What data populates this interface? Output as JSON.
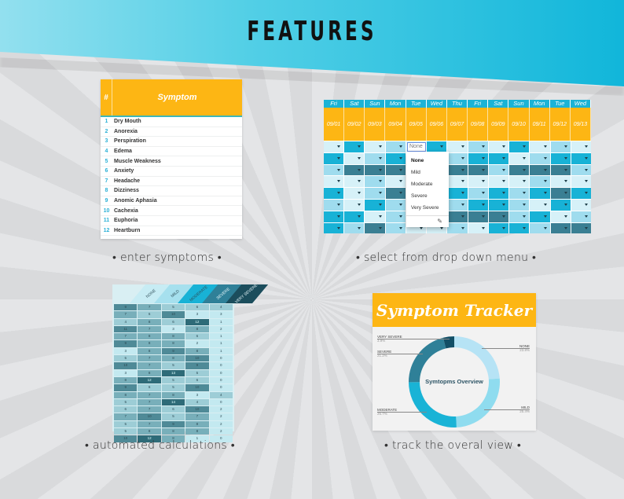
{
  "page": {
    "title": "FEATURES",
    "captions": [
      "• enter symptoms •",
      "• select from drop down menu •",
      "• automated calculations •",
      "• track the overal view •"
    ]
  },
  "symptom_list": {
    "header_hash": "#",
    "header_label": "Symptom",
    "rows": [
      {
        "num": "1",
        "name": "Dry Mouth"
      },
      {
        "num": "2",
        "name": "Anorexia"
      },
      {
        "num": "3",
        "name": "Perspiration"
      },
      {
        "num": "4",
        "name": "Edema"
      },
      {
        "num": "5",
        "name": "Muscle Weakness"
      },
      {
        "num": "6",
        "name": "Anxiety"
      },
      {
        "num": "7",
        "name": "Headache"
      },
      {
        "num": "8",
        "name": "Dizziness"
      },
      {
        "num": "9",
        "name": "Anomic Aphasia"
      },
      {
        "num": "10",
        "name": "Cachexia"
      },
      {
        "num": "11",
        "name": "Euphoria"
      },
      {
        "num": "12",
        "name": "Heartburn"
      }
    ]
  },
  "tracker_grid": {
    "days": [
      "Fri",
      "Sat",
      "Sun",
      "Mon",
      "Tue",
      "Wed",
      "Thu",
      "Fri",
      "Sat",
      "Sun",
      "Mon",
      "Tue",
      "Wed"
    ],
    "dates": [
      "09/01",
      "09/02",
      "09/03",
      "09/04",
      "09/05",
      "09/06",
      "09/07",
      "09/08",
      "09/09",
      "09/10",
      "09/11",
      "09/12",
      "09/13"
    ],
    "severity_levels": [
      [
        0,
        2,
        0,
        1,
        0,
        2,
        0,
        1,
        0,
        2,
        0,
        1,
        0
      ],
      [
        2,
        0,
        1,
        2,
        0,
        0,
        1,
        2,
        2,
        0,
        1,
        2,
        2
      ],
      [
        1,
        3,
        3,
        3,
        0,
        0,
        3,
        3,
        1,
        3,
        3,
        3,
        1
      ],
      [
        0,
        0,
        1,
        0,
        0,
        0,
        0,
        0,
        0,
        0,
        1,
        0,
        0
      ],
      [
        2,
        0,
        1,
        3,
        0,
        0,
        2,
        1,
        2,
        1,
        2,
        3,
        2
      ],
      [
        1,
        0,
        2,
        1,
        0,
        0,
        1,
        2,
        2,
        1,
        0,
        2,
        0
      ],
      [
        2,
        2,
        0,
        1,
        0,
        0,
        3,
        3,
        3,
        1,
        2,
        0,
        1
      ],
      [
        2,
        1,
        3,
        1,
        0,
        0,
        1,
        0,
        2,
        2,
        1,
        3,
        3
      ]
    ],
    "dropdown": {
      "current_value": "None",
      "options": [
        "None",
        "Mild",
        "Moderate",
        "Severe",
        "Very Severe"
      ],
      "edit_icon": "pencil-icon"
    }
  },
  "calculations": {
    "headers": [
      "NONE",
      "MILD",
      "MODERATE",
      "SEVERE",
      "VERY SEVERE"
    ],
    "rows": [
      [
        "9",
        "7",
        "5",
        "6",
        "4"
      ],
      [
        "7",
        "6",
        "10",
        "3",
        "3"
      ],
      [
        "4",
        "8",
        "6",
        "12",
        "1"
      ],
      [
        "11",
        "7",
        "3",
        "8",
        "2"
      ],
      [
        "7",
        "8",
        "8",
        "6",
        "1"
      ],
      [
        "9",
        "8",
        "8",
        "2",
        "1"
      ],
      [
        "3",
        "8",
        "9",
        "8",
        "1"
      ],
      [
        "5",
        "7",
        "8",
        "10",
        "0"
      ],
      [
        "10",
        "7",
        "5",
        "9",
        "0"
      ],
      [
        "3",
        "8",
        "13",
        "5",
        "0"
      ],
      [
        "8",
        "12",
        "5",
        "6",
        "0"
      ],
      [
        "9",
        "6",
        "5",
        "10",
        "0"
      ],
      [
        "8",
        "7",
        "8",
        "3",
        "4"
      ],
      [
        "5",
        "7",
        "14",
        "4",
        "0"
      ],
      [
        "6",
        "7",
        "6",
        "10",
        "2"
      ],
      [
        "7",
        "10",
        "5",
        "7",
        "2"
      ],
      [
        "5",
        "7",
        "9",
        "8",
        "2"
      ],
      [
        "5",
        "8",
        "8",
        "8",
        "2"
      ],
      [
        "10",
        "12",
        "8",
        "1",
        "0"
      ]
    ]
  },
  "overview": {
    "title": "Symptom Tracker",
    "chart_data": {
      "type": "pie",
      "title": "Symtopms Overview",
      "categories": [
        "NONE",
        "MILD",
        "MODERATE",
        "SEVERE",
        "VERY SEVERE"
      ],
      "values": [
        23.8,
        25.4,
        25.7,
        21.2,
        3.9
      ],
      "labels": [
        "23.8%",
        "25.4%",
        "25.7%",
        "21.2%",
        "3.9%"
      ],
      "colors": [
        "#b6e3f5",
        "#8fdcef",
        "#19b3d6",
        "#2f8098",
        "#124f66"
      ]
    }
  }
}
